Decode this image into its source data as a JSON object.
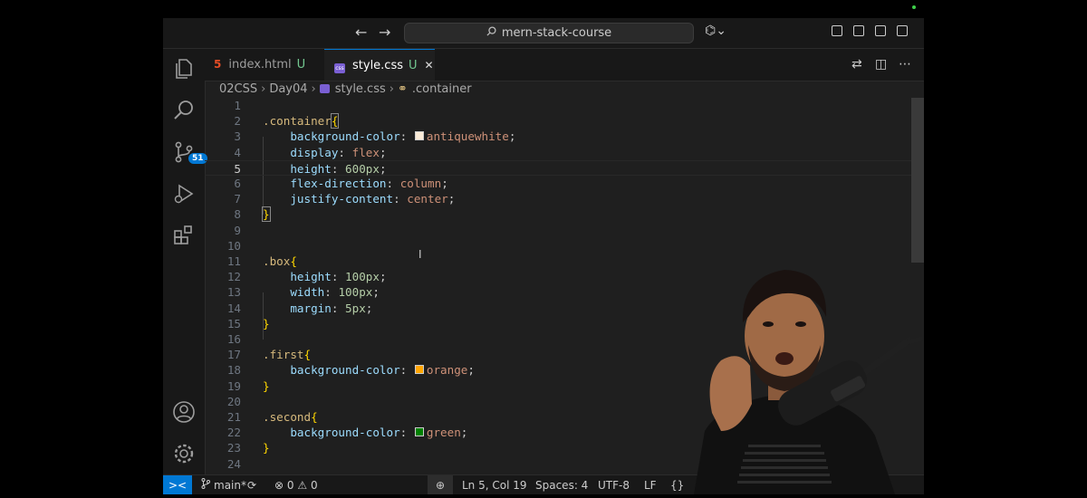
{
  "titlebar": {
    "back_arrow": "←",
    "forward_arrow": "→",
    "search_text": "mern-stack-course",
    "copilot": "⌬⌄"
  },
  "activity": {
    "icons": [
      "explorer-icon",
      "search-icon",
      "source-control-icon",
      "run-debug-icon",
      "extensions-icon",
      "account-icon",
      "settings-icon"
    ],
    "scm_badge": "51"
  },
  "tabs": [
    {
      "label": "index.html",
      "status": "U",
      "icon": "5",
      "active": false
    },
    {
      "label": "style.css",
      "status": "U",
      "icon": "css",
      "active": true,
      "close": "✕"
    }
  ],
  "breadcrumb": {
    "items": [
      "02CSS",
      "Day04",
      "style.css",
      ".container"
    ],
    "separator": "›"
  },
  "editor": {
    "lines": [
      {
        "n": "1"
      },
      {
        "n": "2"
      },
      {
        "n": "3"
      },
      {
        "n": "4"
      },
      {
        "n": "5"
      },
      {
        "n": "6"
      },
      {
        "n": "7"
      },
      {
        "n": "8"
      },
      {
        "n": "9"
      },
      {
        "n": "10"
      },
      {
        "n": "11"
      },
      {
        "n": "12"
      },
      {
        "n": "13"
      },
      {
        "n": "14"
      },
      {
        "n": "15"
      },
      {
        "n": "16"
      },
      {
        "n": "17"
      },
      {
        "n": "18"
      },
      {
        "n": "19"
      },
      {
        "n": "20"
      },
      {
        "n": "21"
      },
      {
        "n": "22"
      },
      {
        "n": "23"
      },
      {
        "n": "24"
      }
    ],
    "code": {
      "l2_sel": ".container",
      "l2_open": "{",
      "l3_prop": "background-color",
      "l3_val": "antiquewhite",
      "l4_prop": "display",
      "l4_val": "flex",
      "l5_prop": "height",
      "l5_val": "600px",
      "l6_prop": "flex-direction",
      "l6_val": "column",
      "l7_prop": "justify-content",
      "l7_val": "center",
      "l8_close": "}",
      "l11_sel": ".box",
      "l11_open": "{",
      "l12_prop": "height",
      "l12_val": "100px",
      "l13_prop": "width",
      "l13_val": "100px",
      "l14_prop": "margin",
      "l14_val": "5px",
      "l15_close": "}",
      "l17_sel": ".first",
      "l17_open": "{",
      "l18_prop": "background-color",
      "l18_val": "orange",
      "l19_close": "}",
      "l21_sel": ".second",
      "l21_open": "{",
      "l22_prop": "background-color",
      "l22_val": "green",
      "l23_close": "}",
      "colon": ":",
      "semi": ";"
    },
    "swatches": {
      "antiquewhite": "#faebd7",
      "orange": "#ffa500",
      "green": "#008000"
    },
    "current_line": "5"
  },
  "statusbar": {
    "remote": "><",
    "branch": "main*",
    "sync": "⟳",
    "errors": "0",
    "warnings": "0",
    "cursor": "Ln 5, Col 19",
    "spaces": "Spaces: 4",
    "encoding": "UTF-8",
    "eol": "LF",
    "language": "{}"
  },
  "colors": {
    "accent": "#0078d4",
    "untracked": "#73c991"
  }
}
